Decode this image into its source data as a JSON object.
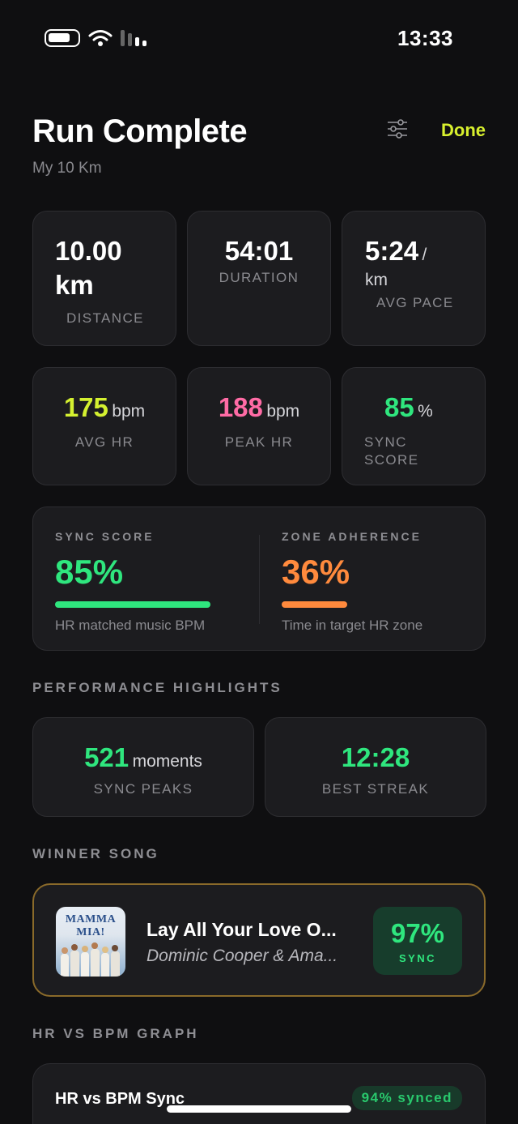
{
  "status_bar": {
    "time": "13:33"
  },
  "header": {
    "title": "Run Complete",
    "subtitle": "My 10 Km",
    "done_label": "Done"
  },
  "stats_row1": [
    {
      "value": "10.00",
      "unit": "km",
      "label": "DISTANCE"
    },
    {
      "value": "54:01",
      "label": "DURATION"
    },
    {
      "value": "5:24",
      "unit_inline": "/",
      "unit": "km",
      "label": "AVG PACE"
    }
  ],
  "stats_row2": [
    {
      "value": "175",
      "unit": "bpm",
      "label": "AVG HR",
      "color": "#d4f030"
    },
    {
      "value": "188",
      "unit": "bpm",
      "label": "PEAK HR",
      "color": "#ff6ba5"
    },
    {
      "value": "85",
      "unit": "%",
      "label_line1": "SYNC",
      "label_line2": "SCORE",
      "color": "#2fe67e"
    }
  ],
  "summary": {
    "sync": {
      "heading": "SYNC SCORE",
      "value": "85%",
      "caption": "HR matched music BPM",
      "color": "#2fe67e",
      "progress": 0.85
    },
    "zone": {
      "heading": "ZONE ADHERENCE",
      "value": "36%",
      "caption": "Time in target HR zone",
      "color": "#ff8a3d",
      "progress": 0.36
    }
  },
  "highlights": {
    "section_title": "PERFORMANCE HIGHLIGHTS",
    "items": [
      {
        "value": "521",
        "unit": "moments",
        "label": "SYNC PEAKS"
      },
      {
        "value": "12:28",
        "label": "BEST STREAK"
      }
    ]
  },
  "winner_song": {
    "section_title": "WINNER SONG",
    "album_text": "MAMMA MIA!",
    "title": "Lay All Your Love O...",
    "artist": "Dominic Cooper & Ama...",
    "sync_value": "97%",
    "sync_label": "SYNC"
  },
  "graph": {
    "section_title": "HR VS BPM GRAPH",
    "card_title": "HR vs BPM Sync",
    "badge": "94% synced"
  }
}
